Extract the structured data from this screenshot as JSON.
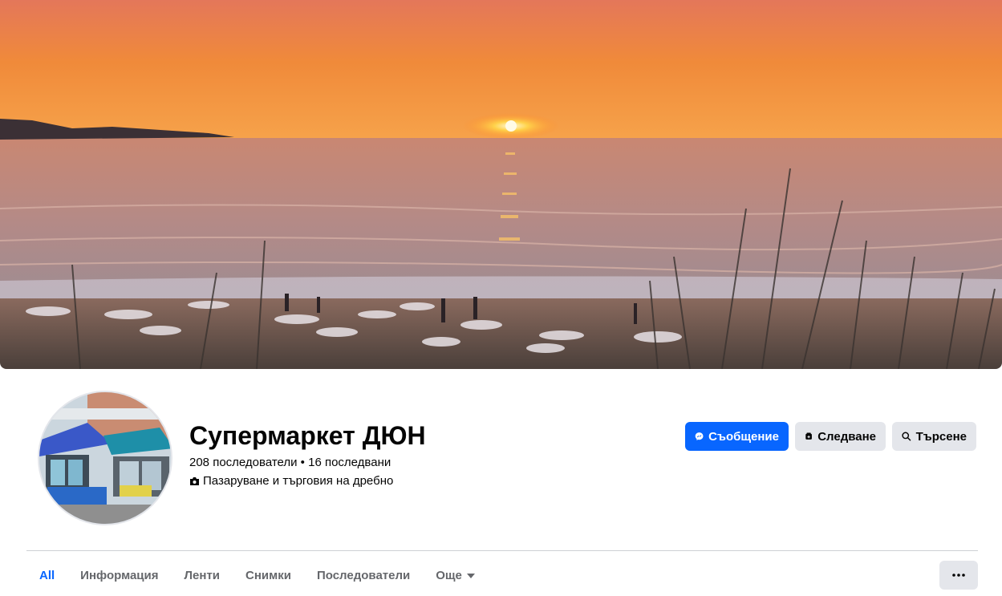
{
  "page": {
    "title": "Супермаркет ДЮН",
    "stats": "208 последователи • 16 последвани",
    "category": "Пазаруване и търговия на дребно"
  },
  "actions": {
    "message_label": "Съобщение",
    "follow_label": "Следване",
    "search_label": "Търсене"
  },
  "tabs": [
    {
      "label": "All",
      "active": true
    },
    {
      "label": "Информация",
      "active": false
    },
    {
      "label": "Ленти",
      "active": false
    },
    {
      "label": "Снимки",
      "active": false
    },
    {
      "label": "Последователи",
      "active": false
    },
    {
      "label": "Още",
      "active": false
    }
  ],
  "icons": {
    "message": "messenger-icon",
    "follow": "follow-icon",
    "search": "search-icon",
    "category": "category-icon",
    "more_tab": "caret-down-icon",
    "overflow": "ellipsis-icon"
  },
  "colors": {
    "accent": "#0866ff",
    "secondary_button": "#e4e6eb",
    "muted_text": "#65676b"
  }
}
